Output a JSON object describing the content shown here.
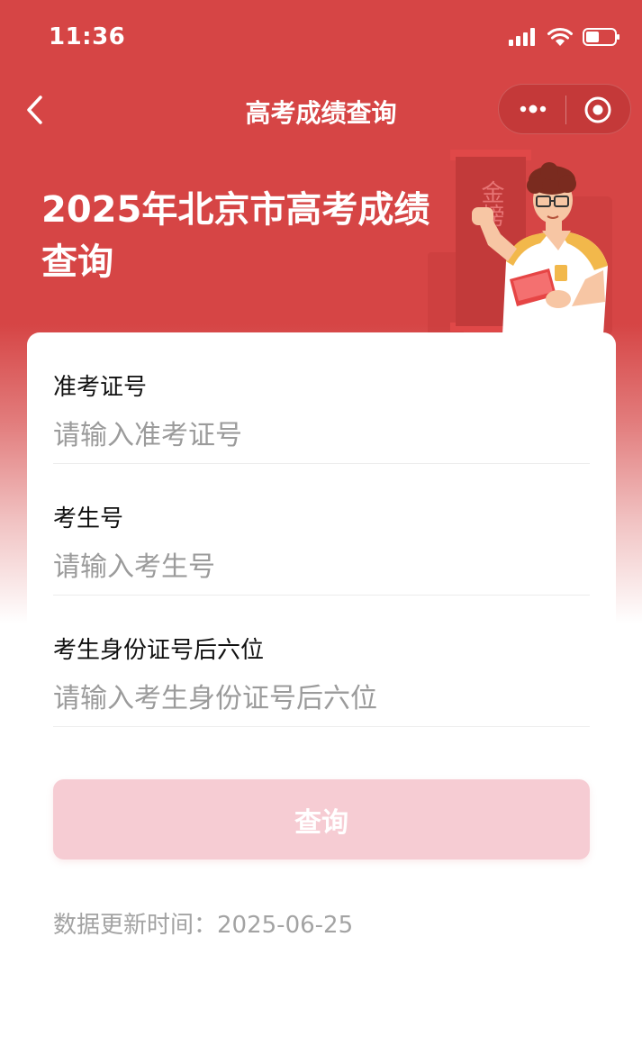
{
  "status_bar": {
    "time": "11:36",
    "battery_level": 0.45
  },
  "nav": {
    "title": "高考成绩查询",
    "back_icon": "chevron-left-icon",
    "more_icon": "more-dots-icon",
    "close_icon": "target-circle-icon"
  },
  "banner": {
    "title": "2025年北京市高考成绩查询",
    "illustration": "student-holding-book-illustration",
    "scroll_text": "金榜"
  },
  "form": {
    "fields": [
      {
        "label": "准考证号",
        "placeholder": "请输入准考证号"
      },
      {
        "label": "考生号",
        "placeholder": "请输入考生号"
      },
      {
        "label": "考生身份证号后六位",
        "placeholder": "请输入考生身份证号后六位"
      }
    ],
    "submit_label": "查询"
  },
  "footer": {
    "update_label": "数据更新时间：",
    "update_date": "2025-06-25"
  },
  "colors": {
    "header_red": "#d64545",
    "button_pink": "#f6ccd3",
    "placeholder_gray": "#9b9b9b"
  }
}
